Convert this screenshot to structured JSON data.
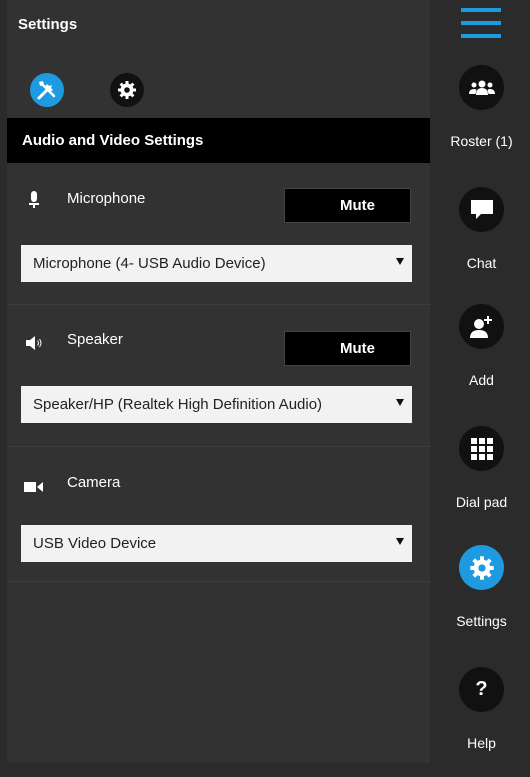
{
  "panel": {
    "title": "Settings",
    "section_title": "Audio and Video Settings"
  },
  "microphone": {
    "label": "Microphone",
    "mute_label": "Mute",
    "selected": "Microphone (4- USB Audio Device)"
  },
  "speaker": {
    "label": "Speaker",
    "mute_label": "Mute",
    "selected": "Speaker/HP (Realtek High Definition Audio)"
  },
  "camera": {
    "label": "Camera",
    "selected": "USB Video Device"
  },
  "sidebar": {
    "items": [
      {
        "label": "Roster (1)",
        "icon": "roster-icon"
      },
      {
        "label": "Chat",
        "icon": "chat-icon"
      },
      {
        "label": "Add",
        "icon": "add-user-icon"
      },
      {
        "label": "Dial pad",
        "icon": "dialpad-icon"
      },
      {
        "label": "Settings",
        "icon": "gear-icon"
      },
      {
        "label": "Help",
        "icon": "help-icon"
      }
    ]
  },
  "colors": {
    "accent": "#1e9be0",
    "panel_bg": "#323232",
    "sidebar_bg": "#2b2b2b"
  }
}
